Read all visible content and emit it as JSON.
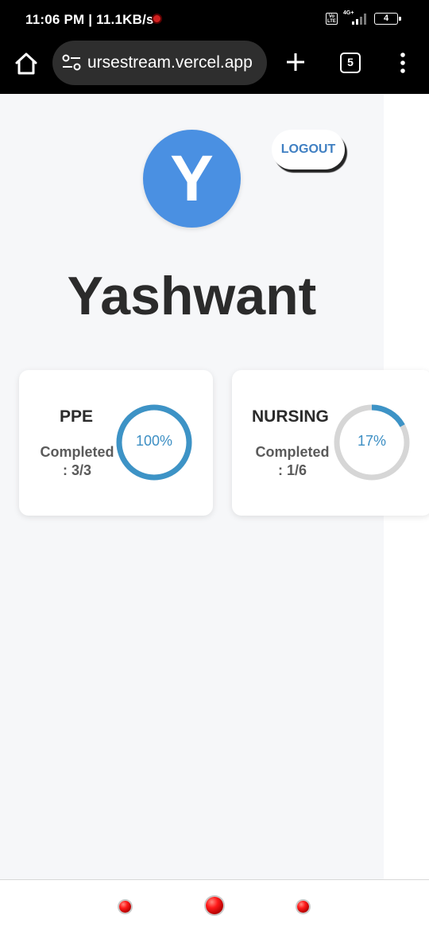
{
  "status_bar": {
    "time_speed": "11:06 PM | 11.1KB/s",
    "volte": "Vo LTE",
    "network": "4G+",
    "battery": "4"
  },
  "browser": {
    "url": "ursestream.vercel.app",
    "tab_count": "5"
  },
  "profile": {
    "avatar_letter": "Y",
    "name": "Yashwant",
    "logout_label": "LOGOUT"
  },
  "courses": [
    {
      "title": "PPE",
      "completed_line1": "Completed",
      "completed_line2": ": 3/3",
      "percent_label": "100%",
      "progress": 1.0,
      "color": "#3d93c6"
    },
    {
      "title": "NURSING",
      "completed_line1": "Completed",
      "completed_line2": ": 1/6",
      "percent_label": "17%",
      "progress": 0.17,
      "color": "#3d93c6"
    }
  ],
  "colors": {
    "accent": "#4a90e2",
    "ring_progress": "#3d93c6",
    "ring_track": "#d6d6d6"
  }
}
